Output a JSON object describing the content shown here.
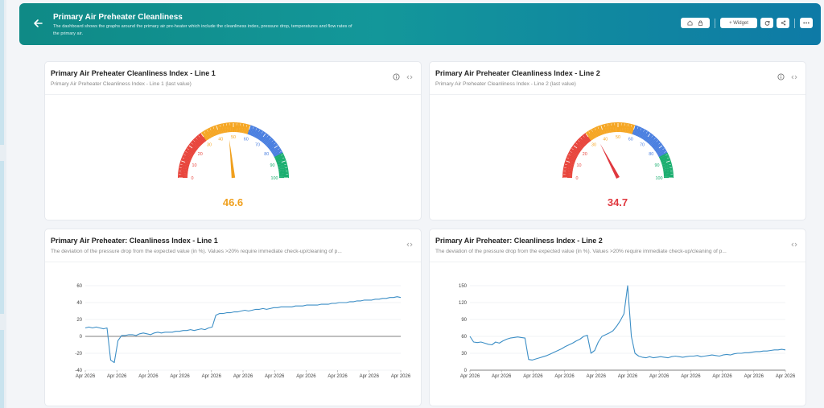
{
  "header": {
    "title": "Primary Air Preheater Cleanliness",
    "description": "The dashboard shows the graphs around the primary air pre-heater which include the cleanliness index, pressure drop, temperatures and flow rates of the primary air.",
    "widget_label": "+ Widget",
    "gradient_colors": [
      "#0f8a86",
      "#0e7aa6"
    ],
    "icons": [
      "back-arrow-icon",
      "home-icon",
      "lock-icon",
      "refresh-icon",
      "share-icon",
      "more-icon"
    ]
  },
  "gauge_scale": {
    "ticks": [
      "0",
      "10",
      "20",
      "30",
      "40",
      "50",
      "60",
      "70",
      "80",
      "90",
      "100"
    ],
    "band_colors": [
      "#e8453c",
      "#f5a623",
      "#4a7fe0",
      "#1aae6f"
    ]
  },
  "gauges": [
    {
      "title": "Primary Air Preheater Cleanliness Index - Line 1",
      "subtitle": "Primary Air Preheater Cleanliness Index - Line 1 (last value)",
      "value": 46.6,
      "display": "46.6",
      "color": "#f0a01e"
    },
    {
      "title": "Primary Air Preheater Cleanliness Index - Line 2",
      "subtitle": "Primary Air Preheater Cleanliness Index - Line 2 (last value)",
      "value": 34.7,
      "display": "34.7",
      "color": "#e0383f"
    }
  ],
  "charts": [
    {
      "title": "Primary Air Preheater: Cleanliness Index - Line 1",
      "subtitle": "The deviation of the pressure drop from the expected value (in %). Values >20% require immediate check-up/cleaning of p..."
    },
    {
      "title": "Primary Air Preheater: Cleanliness Index - Line 2",
      "subtitle": "The deviation of the pressure drop from the expected value (in %). Values >20% require immediate check-up/cleaning of p..."
    }
  ],
  "chart_data": [
    {
      "type": "line",
      "title": "",
      "ylim": [
        -40,
        60
      ],
      "yticks": [
        "60",
        "40",
        "20",
        "0",
        "-20",
        "-40"
      ],
      "x": [
        "Apr 2026",
        "Apr 2026",
        "Apr 2026",
        "Apr 2026",
        "Apr 2026",
        "Apr 2026",
        "Apr 2026",
        "Apr 2026",
        "Apr 2026",
        "Apr 2026",
        "Apr 2026"
      ],
      "series": [
        {
          "color": "#3d8fc6",
          "values": [
            10,
            11,
            10,
            11,
            10,
            9,
            10,
            -28,
            -31,
            -5,
            1,
            1,
            2,
            2,
            1,
            3,
            4,
            3,
            2,
            4,
            5,
            4,
            5,
            5,
            5,
            6,
            6,
            7,
            7,
            8,
            7,
            8,
            9,
            8,
            10,
            11,
            25,
            27,
            27,
            28,
            28,
            29,
            29,
            30,
            31,
            30,
            31,
            32,
            32,
            33,
            32,
            33,
            34,
            34,
            35,
            35,
            35,
            35,
            36,
            36,
            36,
            37,
            37,
            37,
            37,
            38,
            38,
            38,
            39,
            39,
            40,
            40,
            40,
            41,
            41,
            42,
            42,
            43,
            43,
            43,
            44,
            44,
            45,
            45,
            46,
            46,
            47,
            46
          ]
        }
      ]
    },
    {
      "type": "line",
      "title": "",
      "ylim": [
        0,
        150
      ],
      "yticks": [
        "150",
        "120",
        "90",
        "60",
        "30",
        "0"
      ],
      "x": [
        "Apr 2026",
        "Apr 2026",
        "Apr 2026",
        "Apr 2026",
        "Apr 2026",
        "Apr 2026",
        "Apr 2026",
        "Apr 2026",
        "Apr 2026",
        "Apr 2026",
        "Apr 2026"
      ],
      "series": [
        {
          "color": "#3d8fc6",
          "values": [
            60,
            50,
            49,
            50,
            48,
            46,
            45,
            50,
            48,
            52,
            55,
            57,
            58,
            59,
            58,
            57,
            19,
            18,
            20,
            22,
            24,
            26,
            29,
            32,
            35,
            38,
            42,
            45,
            48,
            52,
            55,
            60,
            62,
            30,
            35,
            50,
            60,
            63,
            66,
            70,
            78,
            88,
            100,
            150,
            60,
            30,
            25,
            23,
            22,
            24,
            22,
            23,
            24,
            23,
            22,
            24,
            25,
            24,
            23,
            24,
            25,
            25,
            26,
            24,
            25,
            26,
            27,
            26,
            25,
            27,
            28,
            27,
            29,
            30,
            30,
            31,
            31,
            32,
            33,
            33,
            34,
            34,
            35,
            36,
            36,
            37,
            36
          ]
        }
      ]
    }
  ]
}
